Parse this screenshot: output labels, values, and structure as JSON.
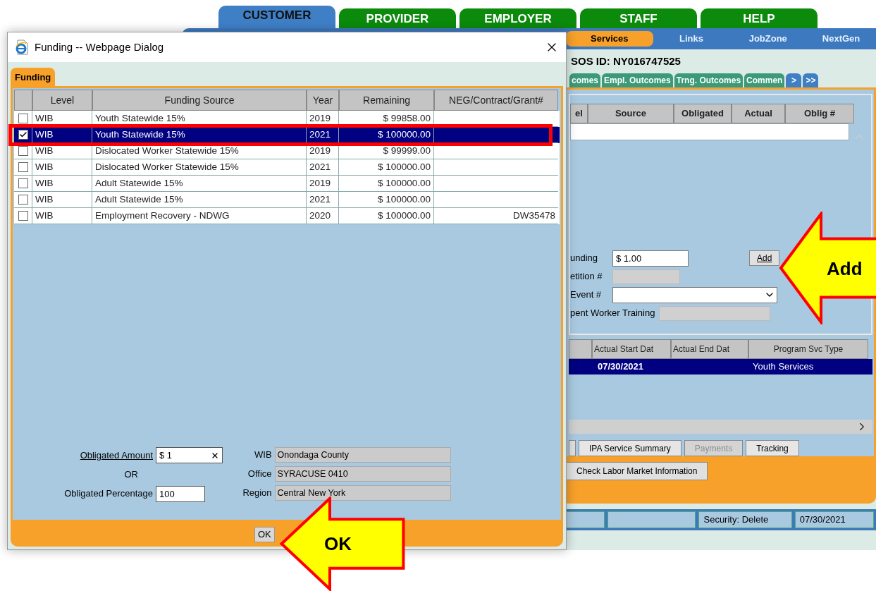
{
  "app": {
    "top_tabs": [
      {
        "label": "CUSTOMER",
        "selected": true
      },
      {
        "label": "PROVIDER",
        "selected": false
      },
      {
        "label": "EMPLOYER",
        "selected": false
      },
      {
        "label": "STAFF",
        "selected": false
      },
      {
        "label": "HELP",
        "selected": false
      }
    ],
    "nav": [
      {
        "label": "Services",
        "selected": true
      },
      {
        "label": "Links",
        "selected": false
      },
      {
        "label": "JobZone",
        "selected": false
      },
      {
        "label": "NextGen",
        "selected": false
      }
    ],
    "sos_id": "SOS ID: NY016747525",
    "sub_tabs": [
      {
        "label": "comes",
        "kind": "tab"
      },
      {
        "label": "Empl. Outcomes",
        "kind": "tab"
      },
      {
        "label": "Trng. Outcomes",
        "kind": "tab"
      },
      {
        "label": "Commen",
        "kind": "tab"
      },
      {
        "label": ">",
        "kind": "arrow"
      },
      {
        "label": ">>",
        "kind": "arrow"
      }
    ],
    "funding_columns": [
      "el",
      "Source",
      "Obligated",
      "Actual",
      "Oblig #"
    ],
    "form": {
      "funding_label": "unding",
      "funding_value": "$ 1.00",
      "add_button": "Add",
      "petition_label": "etition #",
      "event_label": "Event #",
      "worker_label": "pent Worker Training"
    },
    "services_columns": [
      "Actual Start Dat",
      "Actual End Dat",
      "Program Svc Type"
    ],
    "services_rows": [
      {
        "start": "07/30/2021",
        "program": "Youth Services",
        "selected": true
      }
    ],
    "buttons": [
      {
        "label": "IPA Service Summary",
        "disabled": false
      },
      {
        "label": "Payments",
        "disabled": true
      },
      {
        "label": "Tracking",
        "disabled": false
      }
    ],
    "labor_button": "Check Labor Market Information",
    "status_bar": [
      "Security: Delete",
      "07/30/2021"
    ]
  },
  "dialog": {
    "title": "Funding -- Webpage Dialog",
    "tab": "Funding",
    "columns": [
      "Level",
      "Funding Source",
      "Year",
      "Remaining",
      "NEG/Contract/Grant#"
    ],
    "rows": [
      {
        "checked": false,
        "selected": false,
        "level": "WIB",
        "source": "Youth Statewide 15%",
        "year": "2019",
        "remaining": "$ 99858.00"
      },
      {
        "checked": true,
        "selected": true,
        "level": "WIB",
        "source": "Youth Statewide 15%",
        "year": "2021",
        "remaining": "$ 100000.00"
      },
      {
        "checked": false,
        "selected": false,
        "level": "WIB",
        "source": "Dislocated Worker Statewide 15%",
        "year": "2019",
        "remaining": "$ 99999.00"
      },
      {
        "checked": false,
        "selected": false,
        "level": "WIB",
        "source": "Dislocated Worker Statewide 15%",
        "year": "2021",
        "remaining": "$ 100000.00"
      },
      {
        "checked": false,
        "selected": false,
        "level": "WIB",
        "source": "Adult Statewide 15%",
        "year": "2019",
        "remaining": "$ 100000.00"
      },
      {
        "checked": false,
        "selected": false,
        "level": "WIB",
        "source": "Adult Statewide 15%",
        "year": "2021",
        "remaining": "$ 100000.00"
      },
      {
        "checked": false,
        "selected": false,
        "level": "WIB",
        "source": "Employment Recovery - NDWG",
        "year": "2020",
        "remaining": "$ 100000.00",
        "grant": "DW35478"
      }
    ],
    "amount_label": "Obligated Amount",
    "amount_value": "$ 1",
    "or": "OR",
    "percentage_label": "Obligated Percentage",
    "percentage_value": "100",
    "info": [
      {
        "label": "WIB",
        "value": "Onondaga County"
      },
      {
        "label": "Office",
        "value": "SYRACUSE 0410"
      },
      {
        "label": "Region",
        "value": "Central New York"
      }
    ],
    "ok_button": "OK"
  },
  "callouts": [
    {
      "label": "Add"
    },
    {
      "label": "OK"
    }
  ]
}
